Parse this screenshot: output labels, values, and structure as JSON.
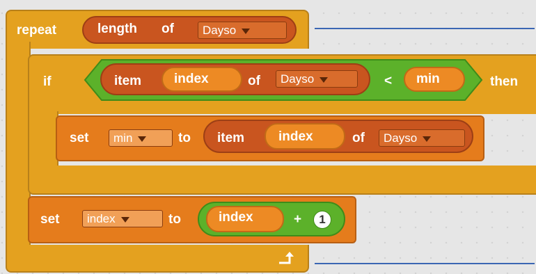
{
  "script": {
    "repeat_block": {
      "keyword": "repeat",
      "length_reporter": {
        "label": "length",
        "of": "of",
        "list_dropdown": "Dayso"
      }
    },
    "if_block": {
      "keyword": "if",
      "then": "then",
      "condition": {
        "item_reporter": {
          "label": "item",
          "index_var": "index",
          "of": "of",
          "list_dropdown": "Dayso"
        },
        "operator": "<",
        "right_var": "min"
      }
    },
    "set_min_block": {
      "keyword": "set",
      "var_dropdown": "min",
      "to": "to",
      "item_reporter": {
        "label": "item",
        "index_var": "index",
        "of": "of",
        "list_dropdown": "Dayso"
      }
    },
    "set_index_block": {
      "keyword": "set",
      "var_dropdown": "index",
      "to": "to",
      "add_expression": {
        "left_var": "index",
        "operator": "+",
        "right_value": "1"
      }
    },
    "loop_arrow": "loop-arrow-icon"
  },
  "colors": {
    "control": "#e4a11f",
    "data": "#e57c1c",
    "list": "#c9551f",
    "operator": "#5cb12a",
    "background": "#e6e6e6",
    "connector_line": "#3b66b3"
  }
}
